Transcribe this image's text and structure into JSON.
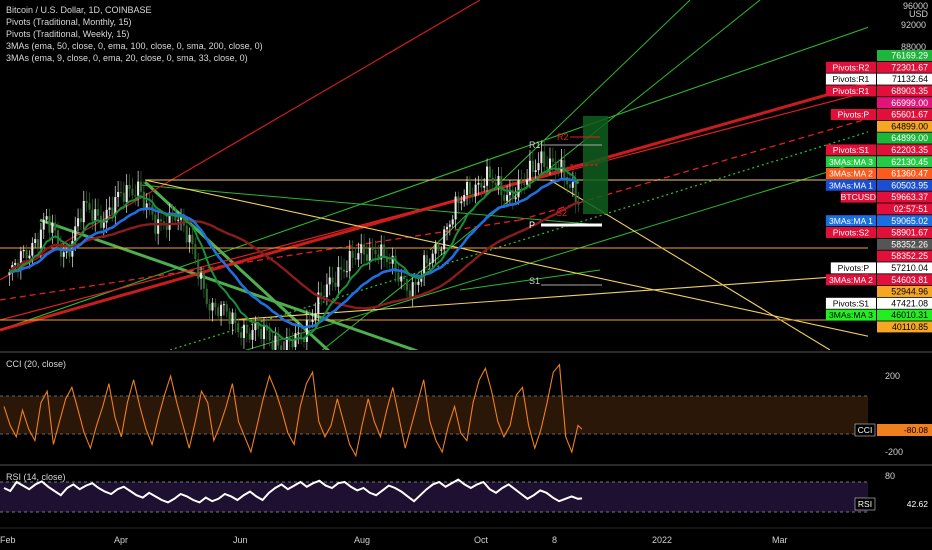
{
  "legend": {
    "title": "Bitcoin / U.S. Dollar, 1D, COINBASE",
    "lines": [
      "Pivots (Traditional, Monthly, 15)",
      "Pivots (Traditional, Weekly, 15)",
      "3MAs (ema, 50, close, 0, ema, 100, close, 0, sma, 200, close, 0)",
      "3MAs (ema, 9, close, 0, ema, 20, close, 0, sma, 33, close, 0)"
    ]
  },
  "currency": "USD",
  "colors": {
    "background": "#000000",
    "red_line": "#e01e1e",
    "green_line": "#2db82d",
    "yellow_line": "#f0d060",
    "ma_blue": "#1f6fe0",
    "ma_green": "#1a8f3a",
    "ma_darkred": "#8b1c1c",
    "cci": "#f07f1e",
    "rsi": "#ffffff"
  },
  "chart_data": [
    {
      "type": "candlestick",
      "title": "Bitcoin / U.S. Dollar, 1D, COINBASE",
      "ylim": [
        40000,
        96000
      ],
      "y_ticks": [
        96000,
        92000,
        88000
      ],
      "x_ticks": [
        "Feb",
        "Apr",
        "Jun",
        "Aug",
        "Oct",
        "8",
        "2022",
        "Mar"
      ],
      "close_path": [
        [
          "Feb",
          44500
        ],
        [
          "Feb",
          49000
        ],
        [
          "Feb",
          55000
        ],
        [
          "Mar",
          48000
        ],
        [
          "Mar",
          57000
        ],
        [
          "Mar",
          55500
        ],
        [
          "Apr",
          59000
        ],
        [
          "Apr",
          62000
        ],
        [
          "Apr",
          53000
        ],
        [
          "May",
          57000
        ],
        [
          "May",
          49000
        ],
        [
          "May",
          38000
        ],
        [
          "Jun",
          37000
        ],
        [
          "Jun",
          33000
        ],
        [
          "Jul",
          34000
        ],
        [
          "Jul",
          30000
        ],
        [
          "Jul",
          34000
        ],
        [
          "Aug",
          40000
        ],
        [
          "Aug",
          46000
        ],
        [
          "Aug",
          48000
        ],
        [
          "Sep",
          50000
        ],
        [
          "Sep",
          45000
        ],
        [
          "Sep",
          42000
        ],
        [
          "Oct",
          48000
        ],
        [
          "Oct",
          55000
        ],
        [
          "Oct",
          61000
        ],
        [
          "Oct",
          63000
        ],
        [
          "Oct",
          60000
        ],
        [
          "Nov",
          61500
        ],
        [
          "Nov",
          67500
        ],
        [
          "Nov",
          64000
        ],
        [
          "Nov",
          59663
        ]
      ],
      "last_price": 59663.37
    },
    {
      "type": "price_labels",
      "labels": [
        {
          "text": "76169.29",
          "tag": "",
          "value": 76169.29,
          "color": "#1db53a"
        },
        {
          "text": "72301.67",
          "tag": "Pivots:R2",
          "value": 72301.67,
          "color": "#e0103a"
        },
        {
          "text": "71132.64",
          "tag": "Pivots:R1",
          "value": 71132.64,
          "color": "#ffffff"
        },
        {
          "text": "68903.35",
          "tag": "Pivots:R1",
          "value": 68903.35,
          "color": "#e0103a"
        },
        {
          "text": "66999.00",
          "tag": "",
          "value": 66999.0,
          "color": "#e0147a"
        },
        {
          "text": "65601.67",
          "tag": "Pivots:P",
          "value": 65601.67,
          "color": "#e0103a"
        },
        {
          "text": "64899.00",
          "tag": "",
          "value": 64899.0,
          "color": "#f5a623"
        },
        {
          "text": "64899.00",
          "tag": "",
          "value": 64899.0,
          "color": "#1db53a"
        },
        {
          "text": "62203.35",
          "tag": "Pivots:S1",
          "value": 62203.35,
          "color": "#e0103a"
        },
        {
          "text": "62130.45",
          "tag": "3MAs:MA 3",
          "value": 62130.45,
          "color": "#22cc44"
        },
        {
          "text": "61360.47",
          "tag": "3MAs:MA 2",
          "value": 61360.47,
          "color": "#ff5a1e"
        },
        {
          "text": "60503.95",
          "tag": "3MAs:MA 1",
          "value": 60503.95,
          "color": "#1a4fd0"
        },
        {
          "text": "59663.37",
          "tag": "BTCUSD",
          "value": 59663.37,
          "color": "#e0103a"
        },
        {
          "text": "02:57:51",
          "tag": "",
          "value": 59663.37,
          "color": "#e0103a"
        },
        {
          "text": "59065.02",
          "tag": "3MAs:MA 1",
          "value": 59065.02,
          "color": "#1a6fe0"
        },
        {
          "text": "58901.67",
          "tag": "Pivots:S2",
          "value": 58901.67,
          "color": "#e0103a"
        },
        {
          "text": "58352.26",
          "tag": "",
          "value": 58352.26,
          "color": "#555555"
        },
        {
          "text": "58352.25",
          "tag": "",
          "value": 58352.25,
          "color": "#e0103a"
        },
        {
          "text": "57210.04",
          "tag": "Pivots:P",
          "value": 57210.04,
          "color": "#ffffff"
        },
        {
          "text": "54603.81",
          "tag": "3MAs:MA 2",
          "value": 54603.81,
          "color": "#e0103a"
        },
        {
          "text": "52944.96",
          "tag": "",
          "value": 52944.96,
          "color": "#f5a623"
        },
        {
          "text": "47421.08",
          "tag": "Pivots:S1",
          "value": 47421.08,
          "color": "#ffffff"
        },
        {
          "text": "46010.31",
          "tag": "3MAs:MA 3",
          "value": 46010.31,
          "color": "#22ee22"
        },
        {
          "text": "40110.85",
          "tag": "",
          "value": 40110.85,
          "color": "#f5a623"
        }
      ],
      "pivot_markers": [
        "R2",
        "R1",
        "S2",
        "P",
        "S1"
      ]
    },
    {
      "type": "line",
      "title": "CCI (20, close)",
      "y_ticks": [
        200.0,
        -200.0
      ],
      "ylim": [
        -280,
        300
      ],
      "last_value": -80.08,
      "label": "CCI",
      "values": [
        40,
        -60,
        -120,
        20,
        -80,
        -140,
        60,
        120,
        -160,
        -40,
        80,
        140,
        20,
        -100,
        -180,
        -60,
        40,
        160,
        -20,
        -120,
        60,
        180,
        40,
        -80,
        -160,
        -20,
        100,
        200,
        60,
        -60,
        -180,
        -40,
        120,
        60,
        -140,
        -60,
        40,
        160,
        -40,
        -120,
        -200,
        -60,
        80,
        200,
        120,
        20,
        -100,
        -160,
        40,
        160,
        220,
        -40,
        -120,
        -60,
        80,
        -40,
        -160,
        -220,
        -60,
        80,
        -40,
        -120,
        20,
        140,
        -20,
        -180,
        -60,
        60,
        180,
        -40,
        -140,
        -200,
        -60,
        40,
        -100,
        -140,
        60,
        180,
        240,
        120,
        -40,
        -120,
        -60,
        100,
        140,
        -60,
        -180,
        -80,
        60,
        220,
        260,
        -120,
        -200,
        -60
      ]
    },
    {
      "type": "line",
      "title": "RSI (14, close)",
      "y_ticks": [
        80.0
      ],
      "ylim": [
        25,
        85
      ],
      "last_value": 42.62,
      "label": "RSI",
      "values": [
        60,
        55,
        70,
        64,
        58,
        66,
        71,
        62,
        55,
        48,
        60,
        66,
        58,
        64,
        68,
        60,
        54,
        50,
        58,
        62,
        55,
        48,
        44,
        52,
        46,
        40,
        36,
        42,
        50,
        46,
        40,
        36,
        44,
        38,
        42,
        50,
        46,
        40,
        48,
        54,
        46,
        40,
        52,
        60,
        66,
        58,
        64,
        70,
        62,
        68,
        72,
        64,
        60,
        68,
        70,
        62,
        56,
        60,
        52,
        48,
        56,
        64,
        60,
        54,
        46,
        38,
        48,
        58,
        66,
        70,
        62,
        68,
        74,
        66,
        60,
        66,
        70,
        58,
        52,
        60,
        66,
        58,
        50,
        42,
        48,
        56,
        52,
        44,
        38,
        42,
        46,
        42
      ]
    }
  ]
}
